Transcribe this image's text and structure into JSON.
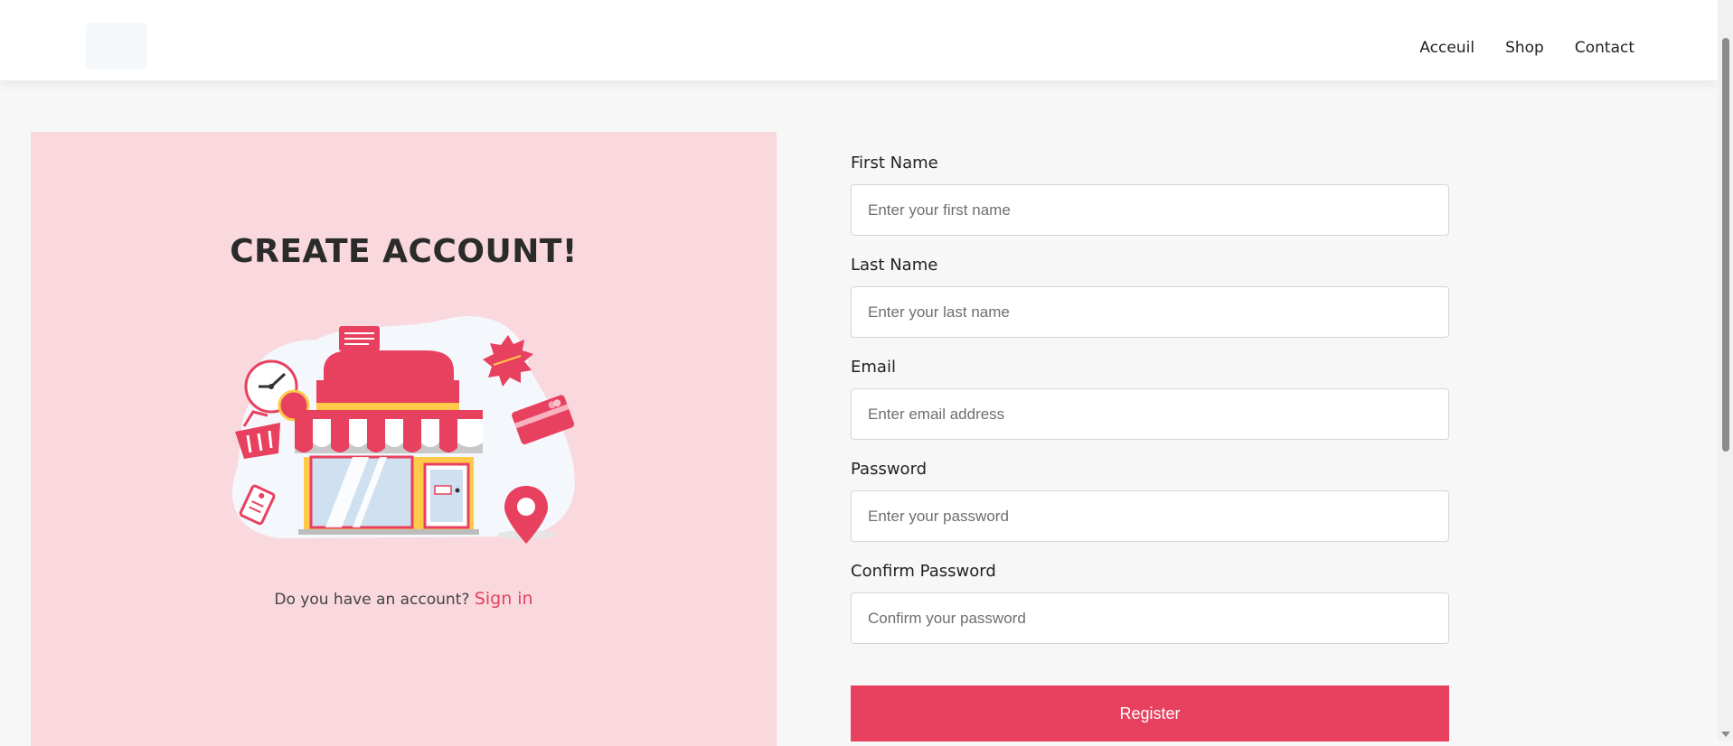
{
  "nav": {
    "items": [
      "Acceuil",
      "Shop",
      "Contact"
    ]
  },
  "left": {
    "title": "CREATE ACCOUNT!",
    "signin_prompt": "Do you have an account?",
    "signin_link": "Sign in"
  },
  "form": {
    "fields": [
      {
        "label": "First Name",
        "placeholder": "Enter your first name",
        "value": ""
      },
      {
        "label": "Last Name",
        "placeholder": "Enter your last name",
        "value": ""
      },
      {
        "label": "Email",
        "placeholder": "Enter email address",
        "value": ""
      },
      {
        "label": "Password",
        "placeholder": "Enter your password",
        "value": ""
      },
      {
        "label": "Confirm Password",
        "placeholder": "Confirm your password",
        "value": ""
      }
    ],
    "submit_label": "Register"
  },
  "colors": {
    "accent": "#e8415f",
    "panel_bg": "#f9d8de",
    "awning_yellow": "#ffc94a"
  },
  "icons": [
    "clock-icon",
    "chat-bubble-icon",
    "badge-icon",
    "basket-icon",
    "credit-card-icon",
    "tag-icon",
    "map-pin-icon",
    "storefront-icon"
  ]
}
